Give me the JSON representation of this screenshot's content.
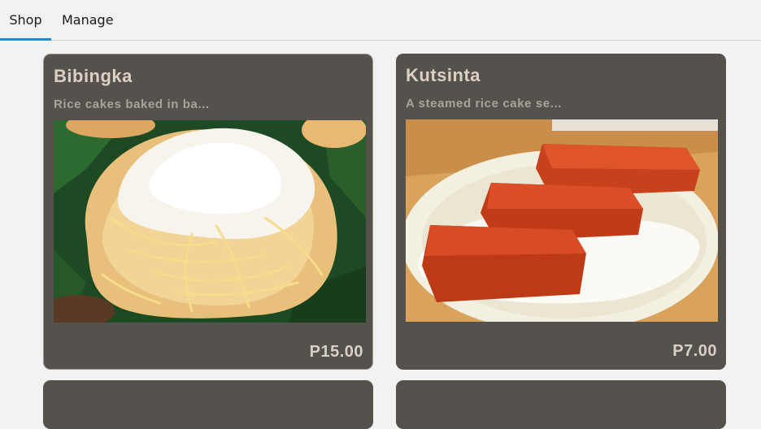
{
  "tabs": [
    {
      "label": "Shop",
      "active": true
    },
    {
      "label": "Manage",
      "active": false
    }
  ],
  "accent_color": "#1f8bd1",
  "card_color": "#55514d",
  "products": [
    {
      "name": "Bibingka",
      "description": "Rice cakes baked in ba...",
      "price": "P15.00",
      "image": "bibingka-photo"
    },
    {
      "name": "Kutsinta",
      "description": "A steamed rice cake se...",
      "price": "P7.00",
      "image": "kutsinta-photo"
    },
    {
      "name": "",
      "image": "product-photo"
    },
    {
      "name": "",
      "image": "product-photo"
    }
  ]
}
